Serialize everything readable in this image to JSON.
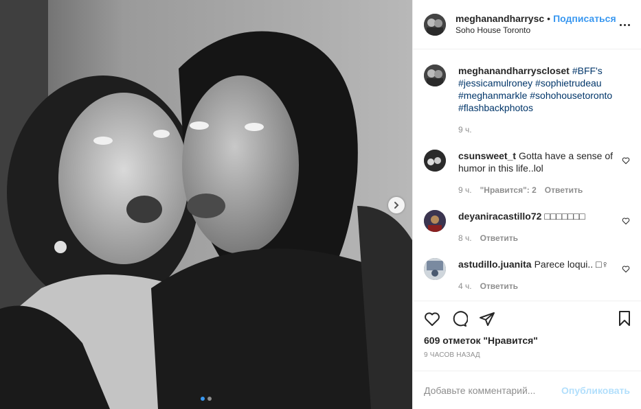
{
  "header": {
    "username": "meghanandharrysc",
    "separator": "•",
    "follow_label": "Подписаться",
    "location": "Soho House Toronto",
    "more_icon": "more-horizontal-icon"
  },
  "caption": {
    "username": "meghanandharryscloset",
    "text": "#BFF's #jessicamulroney #sophietrudeau #meghanmarkle #sohohousetoronto #flashbackphotos",
    "time": "9 ч."
  },
  "comments": [
    {
      "username": "csunsweet_t",
      "text": "Gotta have a sense of humor in this life..lol",
      "time": "9 ч.",
      "likes": "\"Нравится\": 2",
      "reply": "Ответить"
    },
    {
      "username": "deyaniracastillo72",
      "text": "□□□□□□□",
      "time": "8 ч.",
      "reply": "Ответить"
    },
    {
      "username": "astudillo.juanita",
      "text": "Parece loqui.. □♀",
      "time": "4 ч.",
      "reply": "Ответить"
    }
  ],
  "actions": {
    "like_icon": "heart-icon",
    "comment_icon": "comment-icon",
    "share_icon": "share-icon",
    "save_icon": "bookmark-icon"
  },
  "likes_count": "609 отметок \"Нравится\"",
  "posted_ago": "9 ЧАСОВ НАЗАД",
  "add_comment": {
    "placeholder": "Добавьте комментарий...",
    "publish_label": "Опубликовать"
  },
  "carousel": {
    "total": 2,
    "current": 1
  },
  "colors": {
    "link": "#3897f0",
    "hashtag": "#003569",
    "muted": "#8e8e8e",
    "publish_disabled": "#b2dffc"
  }
}
